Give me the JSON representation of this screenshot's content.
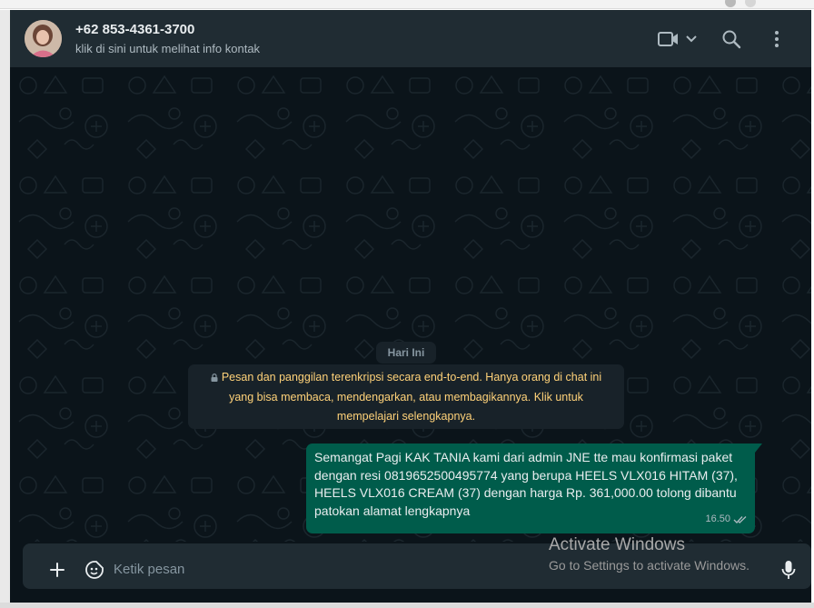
{
  "header": {
    "contact_name": "+62 853-4361-3700",
    "contact_subtitle": "klik di sini untuk melihat info kontak",
    "icons": [
      "video-call-icon",
      "chevron-down-icon",
      "search-icon",
      "menu-dots-icon"
    ]
  },
  "chat": {
    "date_label": "Hari Ini",
    "encryption_notice": "Pesan dan panggilan terenkripsi secara end-to-end. Hanya orang di chat ini yang bisa membaca, mendengarkan, atau membagikannya. Klik untuk mempelajari selengkapnya.",
    "messages": [
      {
        "direction": "outgoing",
        "text": "Semangat Pagi KAK TANIA kami dari admin JNE tte mau konfirmasi paket dengan resi 0819652500495774 yang berupa HEELS VLX016 HITAM (37), HEELS VLX016 CREAM (37) dengan harga Rp. 361,000.00 tolong dibantu patokan alamat lengkapnya",
        "time": "16.50",
        "status": "double-check-icon"
      }
    ]
  },
  "composer": {
    "placeholder": "Ketik pesan",
    "icons": [
      "plus-icon",
      "sticker-icon",
      "microphone-icon"
    ]
  },
  "watermark": {
    "title": "Activate Windows",
    "subtitle": "Go to Settings to activate Windows."
  },
  "colors": {
    "header_bg": "#202c33",
    "chat_bg": "#0b141a",
    "outgoing_bubble": "#005c4b",
    "system_chip": "#182229",
    "encryption_text": "#ffd279",
    "primary_text": "#e9edef",
    "secondary_text": "#8696a0"
  }
}
